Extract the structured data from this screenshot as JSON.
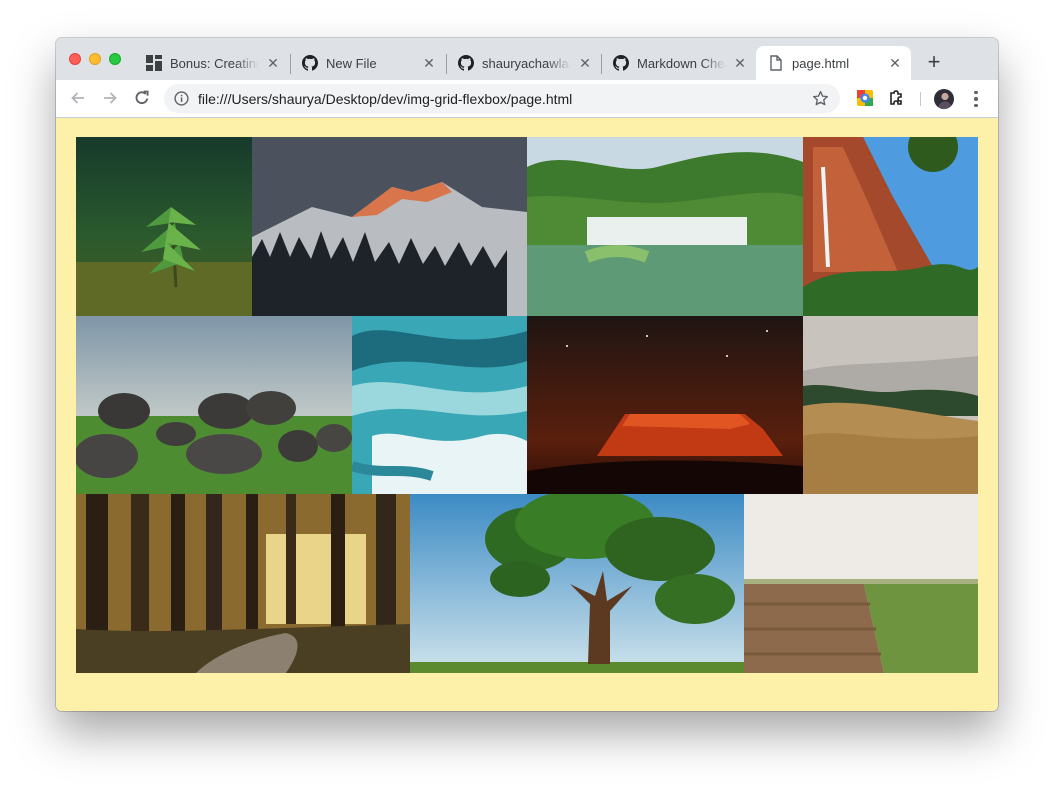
{
  "window": {
    "tabs": [
      {
        "title": "Bonus: Creating",
        "favicon": "grid-icon",
        "active": false
      },
      {
        "title": "New File",
        "favicon": "github-icon",
        "active": false
      },
      {
        "title": "shauryachawla/",
        "favicon": "github-icon",
        "active": false
      },
      {
        "title": "Markdown Chea",
        "favicon": "github-icon",
        "active": false
      },
      {
        "title": "page.html",
        "favicon": "file-icon",
        "active": true
      }
    ],
    "new_tab_label": "+"
  },
  "toolbar": {
    "url": "file:///Users/shaurya/Desktop/dev/img-grid-flexbox/page.html",
    "icons": [
      "back-icon",
      "forward-icon",
      "reload-icon",
      "info-icon",
      "star-icon",
      "extension-icon",
      "puzzle-icon",
      "avatar",
      "menu-icon"
    ]
  },
  "page": {
    "background": "#fdf0a8",
    "gallery": {
      "rows": [
        [
          "seedling",
          "mountain-sunset",
          "waterfall",
          "red-cliff"
        ],
        [
          "boulders",
          "rapids",
          "desert-night-rock",
          "hills"
        ],
        [
          "forest-path",
          "tree",
          "field"
        ]
      ]
    }
  },
  "colors": {
    "tabstrip": "#dee1e6",
    "close": "#ff5f57",
    "minimize": "#febc2e",
    "maximize": "#28c840"
  }
}
